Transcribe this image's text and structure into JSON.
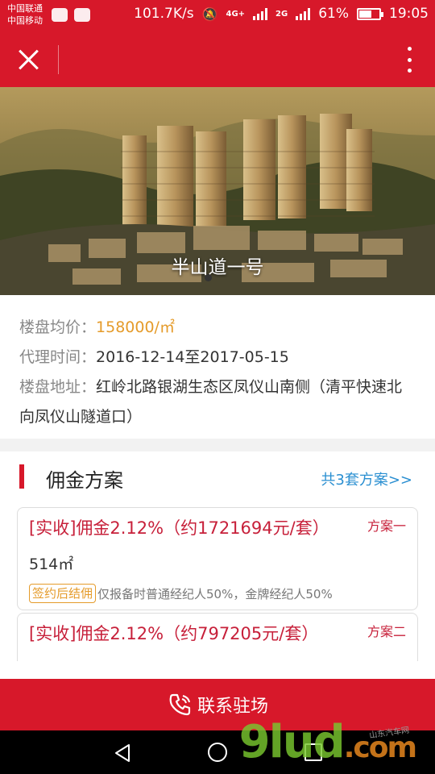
{
  "status_bar": {
    "carrier_1": "中国联通",
    "carrier_2": "中国移动",
    "net_speed": "101.7K/s",
    "net_4g_1": "4G+",
    "net_4g_2": "4G",
    "net_2g": "2G",
    "battery_text": "61%",
    "battery_level": 0.61,
    "time": "19:05"
  },
  "titlebar": {
    "close_icon": "close-icon",
    "more_icon": "more-vertical-icon"
  },
  "hero": {
    "title": "半山道一号"
  },
  "info": {
    "price_label": "楼盘均价：",
    "price_value": "158000/㎡",
    "period_label": "代理时间：",
    "period_value": "2016-12-14至2017-05-15",
    "address_label": "楼盘地址：",
    "address_value": "红岭北路银湖生态区凤仪山南侧（清平快速北向凤仪山隧道口）"
  },
  "commission": {
    "title": "佣金方案",
    "more_link": "共3套方案>>",
    "plans": [
      {
        "title": "[实收]佣金2.12%（约1721694元/套）",
        "tag": "方案一",
        "area": "514㎡",
        "pill": "签约后结佣",
        "note": "仅报备时普通经纪人50%，金牌经纪人50%"
      },
      {
        "title": "[实收]佣金2.12%（约797205元/套）",
        "tag": "方案二"
      }
    ]
  },
  "contact": {
    "label": "联系驻场",
    "icon": "phone-icon"
  },
  "watermark": {
    "brand_a": "9lud",
    "brand_b": ".com",
    "small": "山东汽车网"
  },
  "colors": {
    "brand_red": "#d7182a",
    "price_orange": "#e59b2a",
    "link_blue": "#2a8fd1",
    "plan_red": "#c7203a"
  }
}
